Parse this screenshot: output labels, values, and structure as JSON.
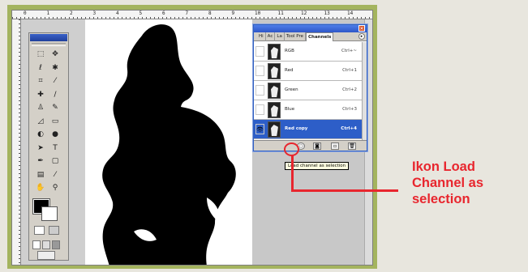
{
  "ruler": {
    "ticks": [
      "0",
      "1",
      "2",
      "3",
      "4",
      "5",
      "6",
      "7",
      "8",
      "9",
      "10",
      "11",
      "12",
      "13",
      "14"
    ]
  },
  "toolbox": {
    "tools": [
      {
        "name": "marquee-tool-icon",
        "glyph": "⬚"
      },
      {
        "name": "move-tool-icon",
        "glyph": "✥"
      },
      {
        "name": "lasso-tool-icon",
        "glyph": "ℓ"
      },
      {
        "name": "magic-wand-icon",
        "glyph": "✱"
      },
      {
        "name": "crop-tool-icon",
        "glyph": "⌗"
      },
      {
        "name": "slice-tool-icon",
        "glyph": "⁄"
      },
      {
        "name": "healing-brush-icon",
        "glyph": "✚"
      },
      {
        "name": "brush-tool-icon",
        "glyph": "/"
      },
      {
        "name": "clone-stamp-icon",
        "glyph": "♙"
      },
      {
        "name": "history-brush-icon",
        "glyph": "✎"
      },
      {
        "name": "eraser-tool-icon",
        "glyph": "◿"
      },
      {
        "name": "gradient-tool-icon",
        "glyph": "▭"
      },
      {
        "name": "blur-tool-icon",
        "glyph": "◐"
      },
      {
        "name": "dodge-tool-icon",
        "glyph": "●"
      },
      {
        "name": "path-select-icon",
        "glyph": "➤"
      },
      {
        "name": "type-tool-icon",
        "glyph": "T"
      },
      {
        "name": "pen-tool-icon",
        "glyph": "✒"
      },
      {
        "name": "shape-tool-icon",
        "glyph": "▢"
      },
      {
        "name": "notes-tool-icon",
        "glyph": "▤"
      },
      {
        "name": "eyedropper-icon",
        "glyph": "⁄"
      },
      {
        "name": "hand-tool-icon",
        "glyph": "✋"
      },
      {
        "name": "zoom-tool-icon",
        "glyph": "⚲"
      }
    ]
  },
  "channels_panel": {
    "tabs": [
      "Hi",
      "Ac",
      "La",
      "Tool Pre",
      "Channels"
    ],
    "active_tab": "Channels",
    "rows": [
      {
        "name": "RGB",
        "shortcut": "Ctrl+~",
        "eye": "",
        "selected": false
      },
      {
        "name": "Red",
        "shortcut": "Ctrl+1",
        "eye": "",
        "selected": false
      },
      {
        "name": "Green",
        "shortcut": "Ctrl+2",
        "eye": "",
        "selected": false
      },
      {
        "name": "Blue",
        "shortcut": "Ctrl+3",
        "eye": "",
        "selected": false
      },
      {
        "name": "Red copy",
        "shortcut": "Ctrl+4",
        "eye": "👁",
        "selected": true
      }
    ]
  },
  "tooltip": "Load channel as selection",
  "callout": {
    "text": "Ikon Load\nChannel as\nselection",
    "color": "#e8262e"
  }
}
